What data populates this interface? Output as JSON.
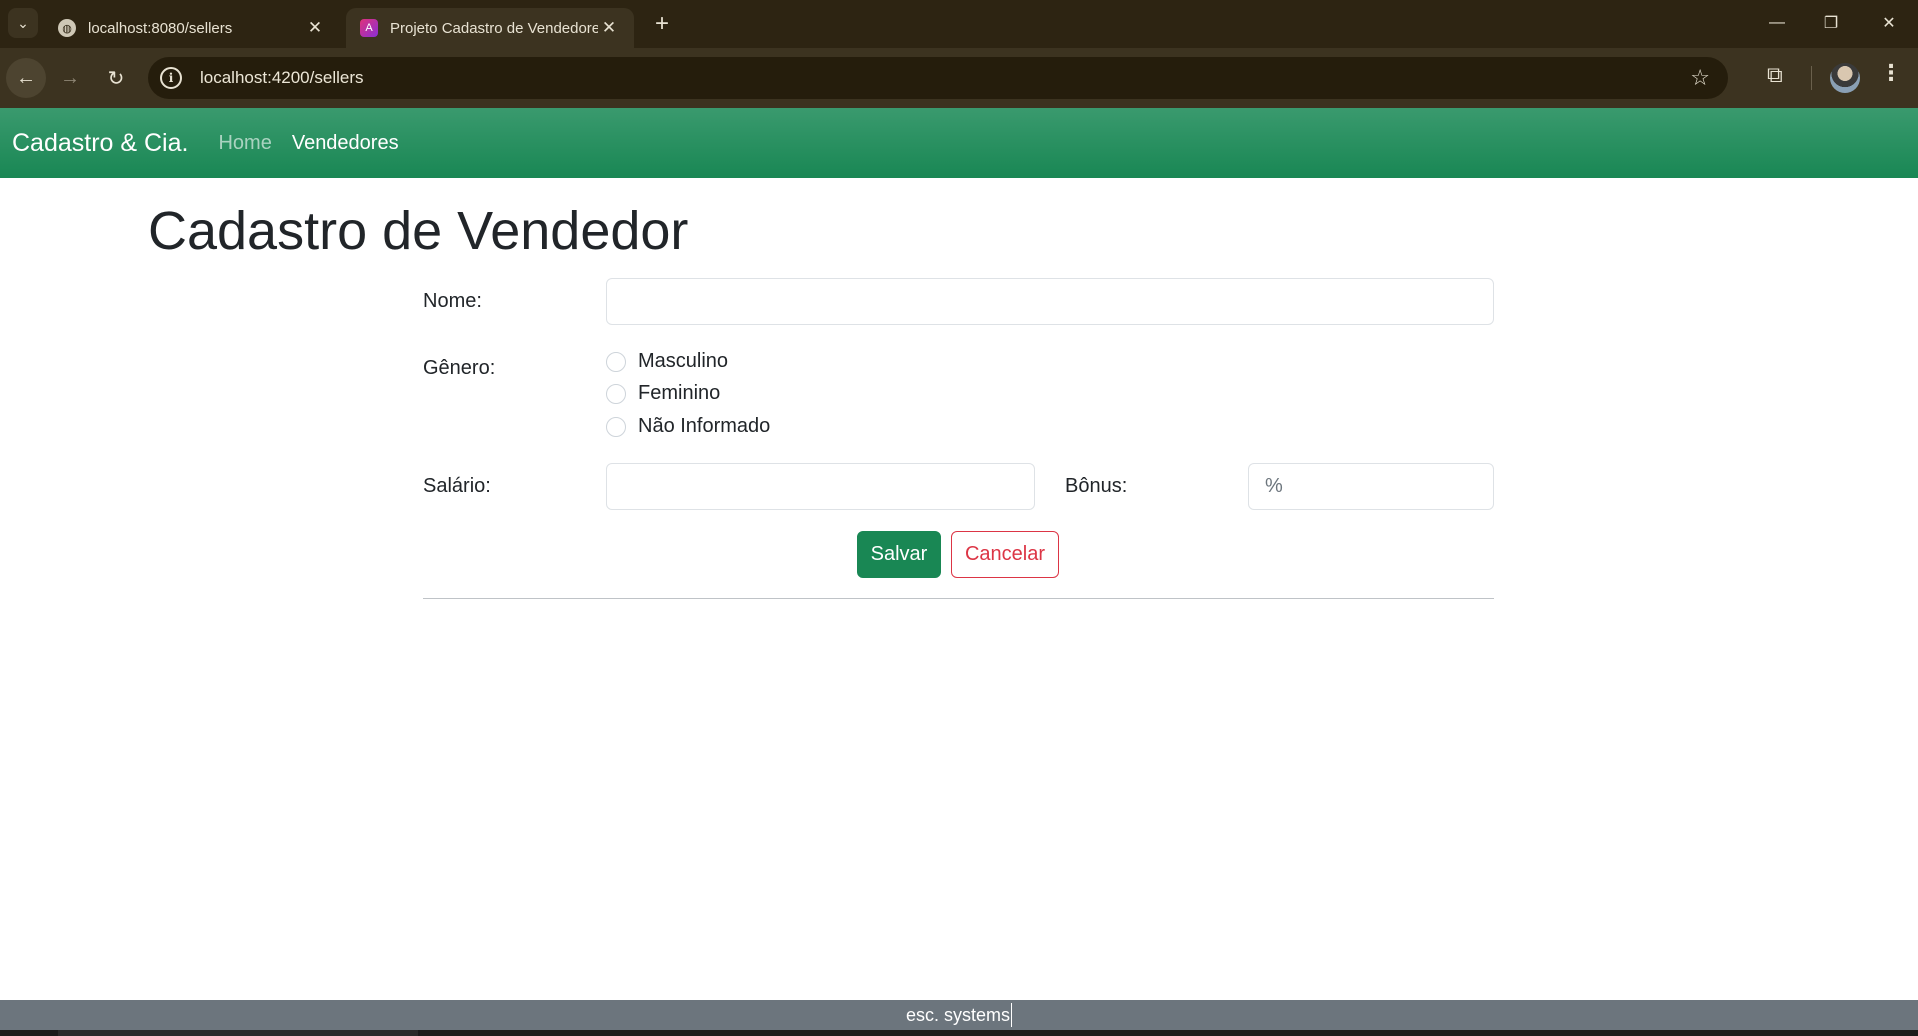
{
  "browser": {
    "tab_menu_icon": "chevron-down-icon",
    "tabs": [
      {
        "title": "localhost:8080/sellers",
        "favicon": "globe-icon",
        "active": false
      },
      {
        "title": "Projeto Cadastro de Vendedores",
        "favicon": "angular-icon",
        "active": true
      }
    ],
    "close_glyph": "✕",
    "new_tab_glyph": "+",
    "window_controls": {
      "minimize": "—",
      "restore": "❐",
      "close": "✕"
    },
    "url": "localhost:4200/sellers",
    "nav_glyphs": {
      "back": "←",
      "forward": "→",
      "reload": "↻",
      "star": "☆",
      "extensions": "⧉",
      "menu": "⋮"
    }
  },
  "app": {
    "brand": "Cadastro & Cia.",
    "nav": {
      "home": "Home",
      "sellers": "Vendedores"
    },
    "accent_color": "#198754"
  },
  "form": {
    "title": "Cadastro de Vendedor",
    "name_label": "Nome:",
    "name_value": "",
    "gender_label": "Gênero:",
    "gender_options": [
      "Masculino",
      "Feminino",
      "Não Informado"
    ],
    "gender_selected": null,
    "salary_label": "Salário:",
    "salary_value": "",
    "bonus_label": "Bônus:",
    "bonus_placeholder": "%",
    "save_label": "Salvar",
    "cancel_label": "Cancelar"
  },
  "footer": {
    "text": "esc. systems"
  }
}
